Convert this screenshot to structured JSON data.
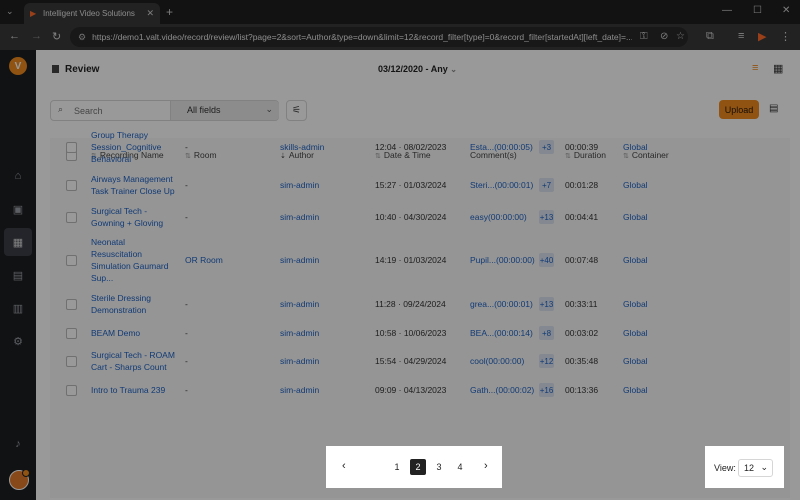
{
  "browser": {
    "tab_title": "Intelligent Video Solutions",
    "url": "https://demo1.valt.video/record/review/list?page=2&sort=Author&type=down&limit=12&record_filter[type]=0&record_filter[startedAt][left_date]=..."
  },
  "header": {
    "title": "Review",
    "date_range": "03/12/2020 - Any"
  },
  "toolbar": {
    "search_placeholder": "Search",
    "search_scope": "All fields",
    "upload_label": "Upload"
  },
  "table": {
    "columns": [
      "Recording Name",
      "Room",
      "Author",
      "Date & Time",
      "Comment(s)",
      "Duration",
      "Container"
    ],
    "rows": [
      {
        "name": [
          "Group Therapy",
          "Session_Cognitive",
          "Behavioral"
        ],
        "room": "-",
        "author": "skills-admin",
        "datetime": "12:04 · 08/02/2023",
        "comment": "Esta...",
        "comment_time": "(00:00:05)",
        "count": "+3",
        "duration": "00:00:39",
        "container": "Global"
      },
      {
        "name": [
          "Airways Management",
          "Task Trainer Close Up"
        ],
        "room": "-",
        "author": "sim-admin",
        "datetime": "15:27 · 01/03/2024",
        "comment": "Steri...",
        "comment_time": "(00:00:01)",
        "count": "+7",
        "duration": "00:01:28",
        "container": "Global"
      },
      {
        "name": [
          "Surgical Tech -",
          "Gowning + Gloving"
        ],
        "room": "-",
        "author": "sim-admin",
        "datetime": "10:40 · 04/30/2024",
        "comment": "easy",
        "comment_time": "(00:00:00)",
        "count": "+13",
        "duration": "00:04:41",
        "container": "Global"
      },
      {
        "name": [
          "Neonatal",
          "Resuscitation",
          "Simulation Gaumard",
          "Sup..."
        ],
        "room": "OR Room",
        "author": "sim-admin",
        "datetime": "14:19 · 01/03/2024",
        "comment": "Pupil...",
        "comment_time": "(00:00:00)",
        "count": "+40",
        "duration": "00:07:48",
        "container": "Global"
      },
      {
        "name": [
          "Sterile Dressing",
          "Demonstration"
        ],
        "room": "-",
        "author": "sim-admin",
        "datetime": "11:28 · 09/24/2024",
        "comment": "grea...",
        "comment_time": "(00:00:01)",
        "count": "+13",
        "duration": "00:33:11",
        "container": "Global"
      },
      {
        "name": [
          "BEAM Demo"
        ],
        "room": "-",
        "author": "sim-admin",
        "datetime": "10:58 · 10/06/2023",
        "comment": "BEA...",
        "comment_time": "(00:00:14)",
        "count": "+8",
        "duration": "00:03:02",
        "container": "Global"
      },
      {
        "name": [
          "Surgical Tech - ROAM",
          "Cart - Sharps Count"
        ],
        "room": "-",
        "author": "sim-admin",
        "datetime": "15:54 · 04/29/2024",
        "comment": "cool",
        "comment_time": "(00:00:00)",
        "count": "+12",
        "duration": "00:35:48",
        "container": "Global"
      },
      {
        "name": [
          "Intro to Trauma 239"
        ],
        "room": "-",
        "author": "sim-admin",
        "datetime": "09:09 · 04/13/2023",
        "comment": "Gath...",
        "comment_time": "(00:00:02)",
        "count": "+16",
        "duration": "00:13:36",
        "container": "Global"
      }
    ]
  },
  "pagination": {
    "pages": [
      "1",
      "2",
      "3",
      "4"
    ],
    "current": "2",
    "view_label": "View:",
    "view_value": "12"
  },
  "colors": {
    "accent": "#f08a1d",
    "link": "#1d62c5",
    "sidebar": "#1c1e22"
  }
}
